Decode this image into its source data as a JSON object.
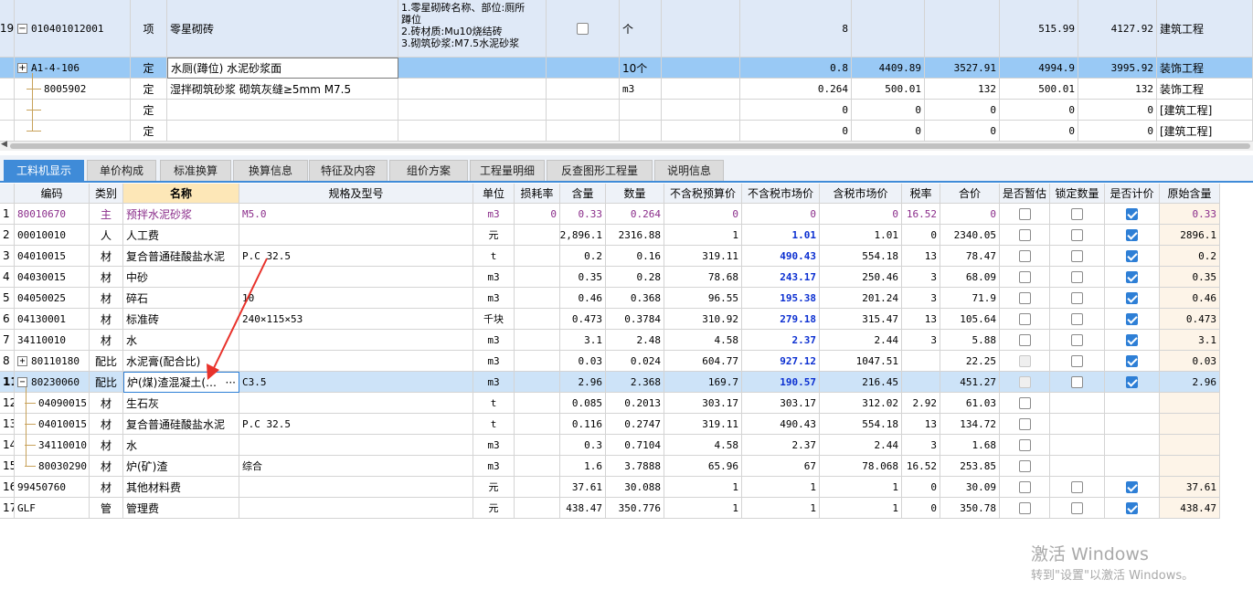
{
  "top_rows": [
    {
      "row_no": "19",
      "expand": "−",
      "code": "010401012001",
      "type": "项",
      "name": "零星砌砖",
      "features": [
        "1.零星砌砖名称、部位:厕所",
        "蹲位",
        "2.砖材质:Mu10烧结砖",
        "3.砌筑砂浆:M7.5水泥砂浆"
      ],
      "unit": "个",
      "qty": "8",
      "c8": "",
      "c9": "",
      "c10": "515.99",
      "c11": "4127.92",
      "spec": "建筑工程"
    },
    {
      "row_no": "",
      "expand": "+",
      "code": "A1-4-106",
      "type": "定",
      "name": "水厕(蹲位) 水泥砂浆面",
      "unit": "10个",
      "qty": "0.8",
      "c8": "4409.89",
      "c9": "3527.91",
      "c10": "4994.9",
      "c11": "3995.92",
      "spec": "装饰工程"
    },
    {
      "row_no": "",
      "expand": "",
      "code": "8005902",
      "type": "定",
      "name": "湿拌砌筑砂浆 砌筑灰缝≥5mm M7.5",
      "unit": "m3",
      "qty": "0.264",
      "c8": "500.01",
      "c9": "132",
      "c10": "500.01",
      "c11": "132",
      "spec": "装饰工程"
    },
    {
      "row_no": "",
      "expand": "",
      "code": "",
      "type": "定",
      "name": "",
      "unit": "",
      "qty": "0",
      "c8": "0",
      "c9": "0",
      "c10": "0",
      "c11": "0",
      "spec": "[建筑工程]"
    },
    {
      "row_no": "",
      "expand": "",
      "code": "",
      "type": "定",
      "name": "",
      "unit": "",
      "qty": "0",
      "c8": "0",
      "c9": "0",
      "c10": "0",
      "c11": "0",
      "spec": "[建筑工程]"
    }
  ],
  "tabs": [
    "工料机显示",
    "单价构成",
    "标准换算",
    "换算信息",
    "特征及内容",
    "组价方案",
    "工程量明细",
    "反查图形工程量",
    "说明信息"
  ],
  "active_tab": "工料机显示",
  "columns": [
    "编码",
    "类别",
    "名称",
    "规格及型号",
    "单位",
    "损耗率",
    "含量",
    "数量",
    "不含税预算价",
    "不含税市场价",
    "含税市场价",
    "税率",
    "合价",
    "是否暂估",
    "锁定数量",
    "是否计价",
    "原始含量"
  ],
  "rows": [
    {
      "no": "1",
      "code": "80010670",
      "cat": "主",
      "name": "预拌水泥砂浆",
      "spec": "M5.0",
      "unit": "m3",
      "loss": "0",
      "content": "0.33",
      "qty": "0.264",
      "pre": "0",
      "mkt": "0",
      "taxmkt": "0",
      "tax": "16.52",
      "total": "0",
      "est": "off",
      "lock": "off",
      "price": "on",
      "orig": "0.33",
      "style": "purple"
    },
    {
      "no": "2",
      "code": "00010010",
      "cat": "人",
      "name": "人工费",
      "spec": "",
      "unit": "元",
      "loss": "",
      "content": "2,896.1",
      "qty": "2316.88",
      "pre": "1",
      "mkt": "1.01",
      "taxmkt": "1.01",
      "tax": "0",
      "total": "2340.05",
      "est": "off",
      "lock": "off",
      "price": "on",
      "orig": "2896.1"
    },
    {
      "no": "3",
      "code": "04010015",
      "cat": "材",
      "name": "复合普通硅酸盐水泥",
      "spec": "P.C 32.5",
      "unit": "t",
      "loss": "",
      "content": "0.2",
      "qty": "0.16",
      "pre": "319.11",
      "mkt": "490.43",
      "taxmkt": "554.18",
      "tax": "13",
      "total": "78.47",
      "est": "off",
      "lock": "off",
      "price": "on",
      "orig": "0.2"
    },
    {
      "no": "4",
      "code": "04030015",
      "cat": "材",
      "name": "中砂",
      "spec": "",
      "unit": "m3",
      "loss": "",
      "content": "0.35",
      "qty": "0.28",
      "pre": "78.68",
      "mkt": "243.17",
      "taxmkt": "250.46",
      "tax": "3",
      "total": "68.09",
      "est": "off",
      "lock": "off",
      "price": "on",
      "orig": "0.35"
    },
    {
      "no": "5",
      "code": "04050025",
      "cat": "材",
      "name": "碎石",
      "spec": "10",
      "unit": "m3",
      "loss": "",
      "content": "0.46",
      "qty": "0.368",
      "pre": "96.55",
      "mkt": "195.38",
      "taxmkt": "201.24",
      "tax": "3",
      "total": "71.9",
      "est": "off",
      "lock": "off",
      "price": "on",
      "orig": "0.46"
    },
    {
      "no": "6",
      "code": "04130001",
      "cat": "材",
      "name": "标准砖",
      "spec": "240×115×53",
      "unit": "千块",
      "loss": "",
      "content": "0.473",
      "qty": "0.3784",
      "pre": "310.92",
      "mkt": "279.18",
      "taxmkt": "315.47",
      "tax": "13",
      "total": "105.64",
      "est": "off",
      "lock": "off",
      "price": "on",
      "orig": "0.473"
    },
    {
      "no": "7",
      "code": "34110010",
      "cat": "材",
      "name": "水",
      "spec": "",
      "unit": "m3",
      "loss": "",
      "content": "3.1",
      "qty": "2.48",
      "pre": "4.58",
      "mkt": "2.37",
      "taxmkt": "2.44",
      "tax": "3",
      "total": "5.88",
      "est": "off",
      "lock": "off",
      "price": "on",
      "orig": "3.1"
    },
    {
      "no": "8",
      "code": "80110180",
      "cat": "配比",
      "name": "水泥膏(配合比)",
      "spec": "",
      "unit": "m3",
      "loss": "",
      "content": "0.03",
      "qty": "0.024",
      "pre": "604.77",
      "mkt": "927.12",
      "taxmkt": "1047.51",
      "tax": "",
      "total": "22.25",
      "est": "dis",
      "lock": "off",
      "price": "on",
      "orig": "0.03",
      "expand": "+"
    },
    {
      "no": "11",
      "code": "80230060",
      "cat": "配比",
      "name": "炉(煤)渣混凝土(…",
      "spec": "C3.5",
      "unit": "m3",
      "loss": "",
      "content": "2.96",
      "qty": "2.368",
      "pre": "169.7",
      "mkt": "190.57",
      "taxmkt": "216.45",
      "tax": "",
      "total": "451.27",
      "est": "dis",
      "lock": "off",
      "price": "on",
      "orig": "2.96",
      "expand": "−",
      "selected": true
    },
    {
      "no": "12",
      "code": "04090015",
      "cat": "材",
      "name": "生石灰",
      "spec": "",
      "unit": "t",
      "loss": "",
      "content": "0.085",
      "qty": "0.2013",
      "pre": "303.17",
      "mkt": "303.17",
      "taxmkt": "312.02",
      "tax": "2.92",
      "total": "61.03",
      "est": "off",
      "lock": "",
      "price": "",
      "orig": "",
      "child": true
    },
    {
      "no": "13",
      "code": "04010015",
      "cat": "材",
      "name": "复合普通硅酸盐水泥",
      "spec": "P.C 32.5",
      "unit": "t",
      "loss": "",
      "content": "0.116",
      "qty": "0.2747",
      "pre": "319.11",
      "mkt": "490.43",
      "taxmkt": "554.18",
      "tax": "13",
      "total": "134.72",
      "est": "off",
      "lock": "",
      "price": "",
      "orig": "",
      "child": true
    },
    {
      "no": "14",
      "code": "34110010",
      "cat": "材",
      "name": "水",
      "spec": "",
      "unit": "m3",
      "loss": "",
      "content": "0.3",
      "qty": "0.7104",
      "pre": "4.58",
      "mkt": "2.37",
      "taxmkt": "2.44",
      "tax": "3",
      "total": "1.68",
      "est": "off",
      "lock": "",
      "price": "",
      "orig": "",
      "child": true
    },
    {
      "no": "15",
      "code": "80030290",
      "cat": "材",
      "name": "炉(矿)渣",
      "spec": "综合",
      "unit": "m3",
      "loss": "",
      "content": "1.6",
      "qty": "3.7888",
      "pre": "65.96",
      "mkt": "67",
      "taxmkt": "78.068",
      "tax": "16.52",
      "total": "253.85",
      "est": "off",
      "lock": "",
      "price": "",
      "orig": "",
      "child": true
    },
    {
      "no": "16",
      "code": "99450760",
      "cat": "材",
      "name": "其他材料费",
      "spec": "",
      "unit": "元",
      "loss": "",
      "content": "37.61",
      "qty": "30.088",
      "pre": "1",
      "mkt": "1",
      "taxmkt": "1",
      "tax": "0",
      "total": "30.09",
      "est": "off",
      "lock": "off",
      "price": "on",
      "orig": "37.61"
    },
    {
      "no": "17",
      "code": "GLF",
      "cat": "管",
      "name": "管理费",
      "spec": "",
      "unit": "元",
      "loss": "",
      "content": "438.47",
      "qty": "350.776",
      "pre": "1",
      "mkt": "1",
      "taxmkt": "1",
      "tax": "0",
      "total": "350.78",
      "est": "off",
      "lock": "off",
      "price": "on",
      "orig": "438.47"
    }
  ],
  "name_cell_more": "···",
  "watermark": {
    "line1": "激活 Windows",
    "line2": "转到\"设置\"以激活 Windows。"
  },
  "colors": {
    "accent": "#3f8bd8",
    "selected_row": "#99c9f5",
    "blue_price": "#0b2fd1",
    "purple_main": "#8a2c8a",
    "annotation_arrow": "#e8322b"
  }
}
